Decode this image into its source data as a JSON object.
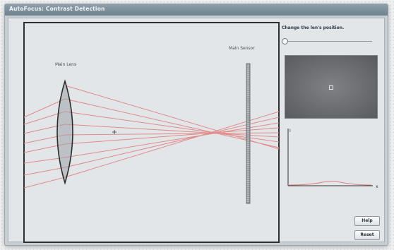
{
  "window": {
    "title": "AutoFocus: Contrast Detection"
  },
  "simulation": {
    "lens_label": "Main Lens",
    "sensor_label": "Main Sensor",
    "ray_color": "#e08a8a"
  },
  "controls": {
    "instruction": "Change the len's position.",
    "slider_position": 0.02
  },
  "graph": {
    "y_axis_label": "I",
    "x_axis_label": "x"
  },
  "buttons": {
    "help_label": "Help",
    "reset_label": "Reset"
  },
  "colors": {
    "titlebar": "#7c8e9a",
    "frame": "#2f2f2f",
    "ray": "#e08a8a"
  }
}
